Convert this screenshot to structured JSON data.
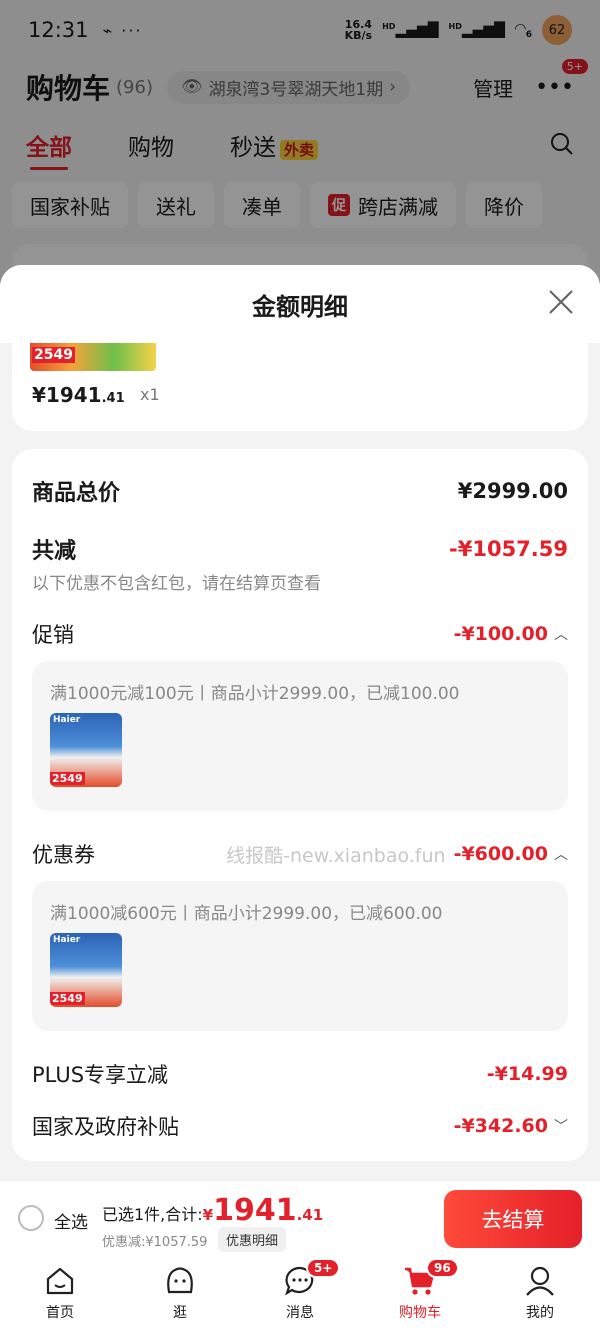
{
  "status_bar": {
    "time": "12:31",
    "left_icons": "⌁ ···",
    "net_speed_value": "16.4",
    "net_speed_unit": "KB/s",
    "signal_1": "HD",
    "signal_2": "HD",
    "wifi_sub": "6",
    "battery": "62"
  },
  "cart_header": {
    "title": "购物车",
    "count": "(96)",
    "address": "湖泉湾3号翠湖天地1期",
    "address_chevron": "›",
    "manage": "管理",
    "more_badge": "5+"
  },
  "tabs": [
    {
      "label": "全部",
      "active": true
    },
    {
      "label": "购物",
      "active": false
    },
    {
      "label": "秒送",
      "active": false,
      "tag": "外卖"
    }
  ],
  "chips": [
    {
      "label": "国家补贴"
    },
    {
      "label": "送礼"
    },
    {
      "label": "凑单"
    },
    {
      "label": "跨店满减",
      "tag": "促"
    },
    {
      "label": "降价"
    }
  ],
  "sheet": {
    "title": "金额明细",
    "product": {
      "thumb_price": "2549",
      "price_int": "¥1941",
      "price_dec": ".41",
      "qty": "x1"
    },
    "total_label": "商品总价",
    "total_value": "¥2999.00",
    "reduce_label": "共减",
    "reduce_value": "-¥1057.59",
    "reduce_note": "以下优惠不包含红包，请在结算页查看",
    "promo_label": "促销",
    "promo_value": "-¥100.00",
    "promo_detail": "满1000元减100元丨商品小计2999.00，已减100.00",
    "coupon_label": "优惠券",
    "coupon_value": "-¥600.00",
    "coupon_detail": "满1000减600元丨商品小计2999.00，已减600.00",
    "watermark": "线报酷-new.xianbao.fun",
    "plus_label": "PLUS专享立减",
    "plus_value": "-¥14.99",
    "subsidy_label": "国家及政府补贴",
    "subsidy_value": "-¥342.60",
    "thumb_brand": "Haier",
    "thumb_price": "2549"
  },
  "checkout": {
    "select_all": "全选",
    "summary_prefix": "已选1件,合计:",
    "yen": "¥",
    "total_int": "1941",
    "total_dec": ".41",
    "discount": "优惠减:¥1057.59",
    "detail_btn": "优惠明细",
    "button": "去结算"
  },
  "bottom_nav": [
    {
      "label": "首页",
      "icon": "home-icon"
    },
    {
      "label": "逛",
      "icon": "browse-icon"
    },
    {
      "label": "消息",
      "icon": "message-icon",
      "badge": "5+"
    },
    {
      "label": "购物车",
      "icon": "cart-icon",
      "badge": "96",
      "active": true
    },
    {
      "label": "我的",
      "icon": "profile-icon"
    }
  ],
  "colors": {
    "accent": "#e4202a",
    "overlay": "rgba(0,0,0,0.42)"
  }
}
